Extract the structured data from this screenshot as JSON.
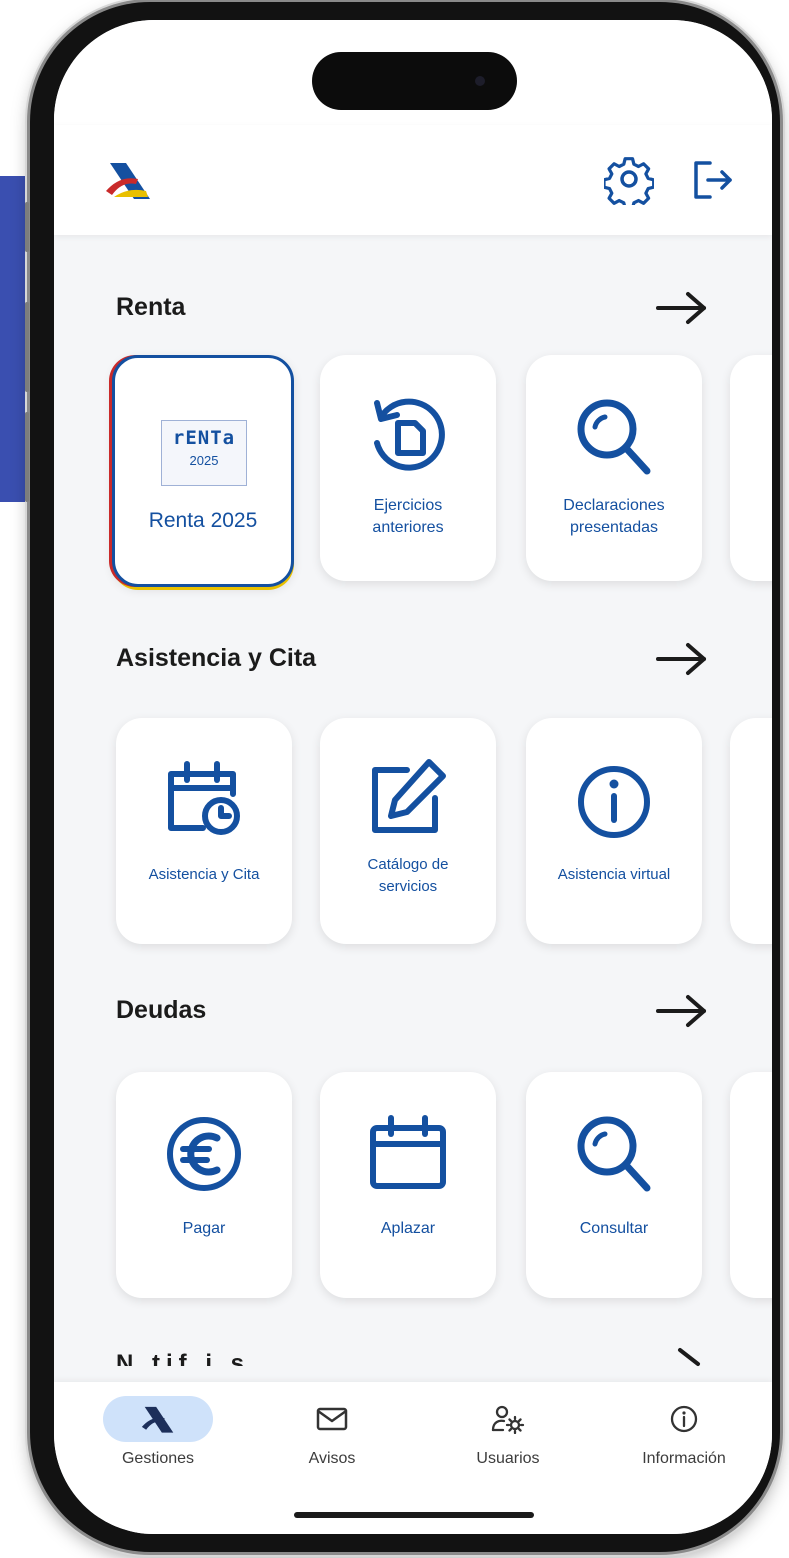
{
  "colors": {
    "primary": "#1450a0",
    "accent_red": "#c92a2a",
    "accent_yellow": "#e9c000",
    "slab": "#3a4fb0"
  },
  "icons": {
    "logo": "agencia-tributaria-logo",
    "settings": "gear-icon",
    "logout": "logout-icon"
  },
  "sections": [
    {
      "title": "Renta",
      "tiles": [
        {
          "label": "Renta 2025",
          "icon": "renta-2025-logo",
          "logo_word": "rENTa",
          "logo_year": "2025"
        },
        {
          "label_line1": "Ejercicios",
          "label_line2": "anteriores",
          "icon": "history-document-icon"
        },
        {
          "label_line1": "Declaraciones",
          "label_line2": "presentadas",
          "icon": "magnifier-icon"
        }
      ]
    },
    {
      "title": "Asistencia y Cita",
      "tiles": [
        {
          "label": "Asistencia y Cita",
          "icon": "calendar-clock-icon"
        },
        {
          "label_line1": "Catálogo de",
          "label_line2": "servicios",
          "icon": "edit-square-icon"
        },
        {
          "label": "Asistencia virtual",
          "icon": "info-circle-icon"
        }
      ]
    },
    {
      "title": "Deudas",
      "tiles": [
        {
          "label": "Pagar",
          "icon": "euro-circle-icon"
        },
        {
          "label": "Aplazar",
          "icon": "calendar-icon"
        },
        {
          "label": "Consultar",
          "icon": "magnifier-icon"
        }
      ]
    }
  ],
  "cutoff_section": {
    "title_fragment": "N  tif     i    s"
  },
  "bottom_nav": [
    {
      "label": "Gestiones",
      "icon": "agencia-tributaria-logo",
      "active": true
    },
    {
      "label": "Avisos",
      "icon": "mail-icon",
      "active": false
    },
    {
      "label": "Usuarios",
      "icon": "user-gear-icon",
      "active": false
    },
    {
      "label": "Información",
      "icon": "info-circle-icon",
      "active": false
    }
  ]
}
